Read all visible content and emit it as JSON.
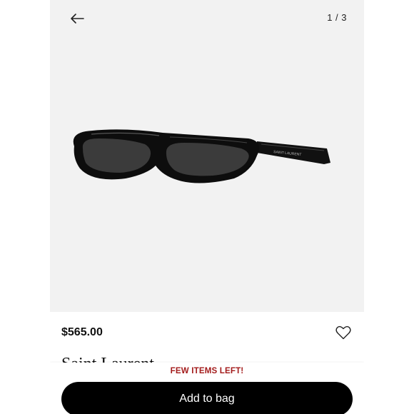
{
  "header": {
    "back_icon": "arrow-left-icon",
    "pager": "1 / 3"
  },
  "product": {
    "image": "black oval sunglasses",
    "price": "$565.00",
    "brand": "Saint Laurent",
    "wishlist_icon": "heart-icon"
  },
  "cta": {
    "stock_note": "FEW ITEMS LEFT!",
    "add_to_bag_label": "Add to bag"
  },
  "colors": {
    "accent_text": "#a31b1b",
    "button_bg": "#000000",
    "gallery_bg": "#f2f2f2"
  }
}
